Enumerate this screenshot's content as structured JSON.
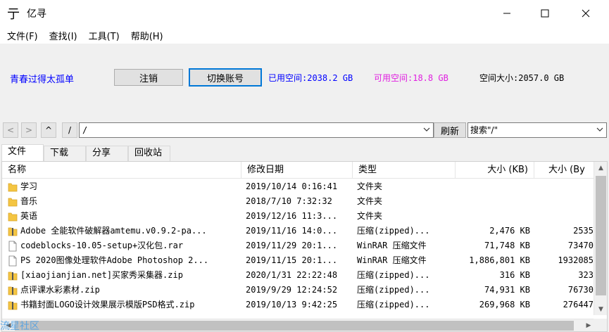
{
  "window": {
    "title": "亿寻",
    "icon": "亍",
    "minimize": "minimize-icon",
    "maximize": "maximize-icon",
    "close": "close-icon"
  },
  "menu": [
    "文件(F)",
    "查找(I)",
    "工具(T)",
    "帮助(H)"
  ],
  "account": {
    "username": "青春过得太孤单",
    "logout_label": "注销",
    "switch_label": "切换账号",
    "used": "已用空间:2038.2 GB",
    "available": "可用空间:18.8 GB",
    "total": "空间大小:2057.0 GB",
    "used_color": "#0000ff",
    "available_color": "#e020e0"
  },
  "nav": {
    "back": "<",
    "forward": ">",
    "up": "^",
    "root": "/",
    "path": "/",
    "refresh_label": "刷新",
    "search_value": "搜索\"/\""
  },
  "tabs": [
    "文件",
    "下载",
    "分享",
    "回收站"
  ],
  "columns": {
    "name": "名称",
    "date": "修改日期",
    "type": "类型",
    "size_kb": "大小 (KB)",
    "size_bytes": "大小 (By"
  },
  "rows": [
    {
      "icon": "folder-icon",
      "name": "学习",
      "date": "2019/10/14 0:16:41",
      "type": "文件夹",
      "kb": "",
      "bytes": ""
    },
    {
      "icon": "folder-icon",
      "name": "音乐",
      "date": "2018/7/10 7:32:32",
      "type": "文件夹",
      "kb": "",
      "bytes": ""
    },
    {
      "icon": "folder-icon",
      "name": "英语",
      "date": "2019/12/16 11:3...",
      "type": "文件夹",
      "kb": "",
      "bytes": ""
    },
    {
      "icon": "zip-icon",
      "name": "Adobe 全能软件破解器amtemu.v0.9.2-pa...",
      "date": "2019/11/16 14:0...",
      "type": "压缩(zipped)...",
      "kb": "2,476 KB",
      "bytes": "2535"
    },
    {
      "icon": "file-icon",
      "name": "codeblocks-10.05-setup+汉化包.rar",
      "date": "2019/11/29 20:1...",
      "type": "WinRAR 压缩文件",
      "kb": "71,748 KB",
      "bytes": "73470"
    },
    {
      "icon": "file-icon",
      "name": "PS 2020图像处理软件Adobe Photoshop 2...",
      "date": "2019/11/15 20:1...",
      "type": "WinRAR 压缩文件",
      "kb": "1,886,801 KB",
      "bytes": "1932085"
    },
    {
      "icon": "zip-icon",
      "name": "[xiaojianjian.net]买家秀采集器.zip",
      "date": "2020/1/31 22:22:48",
      "type": "压缩(zipped)...",
      "kb": "316 KB",
      "bytes": "323"
    },
    {
      "icon": "zip-icon",
      "name": "点评课水彩素材.zip",
      "date": "2019/9/29 12:24:52",
      "type": "压缩(zipped)...",
      "kb": "74,931 KB",
      "bytes": "76730"
    },
    {
      "icon": "zip-icon",
      "name": "书籍封面LOGO设计效果展示模版PSD格式.zip",
      "date": "2019/10/13 9:42:25",
      "type": "压缩(zipped)...",
      "kb": "269,968 KB",
      "bytes": "276447"
    }
  ],
  "watermark": "流星社区"
}
